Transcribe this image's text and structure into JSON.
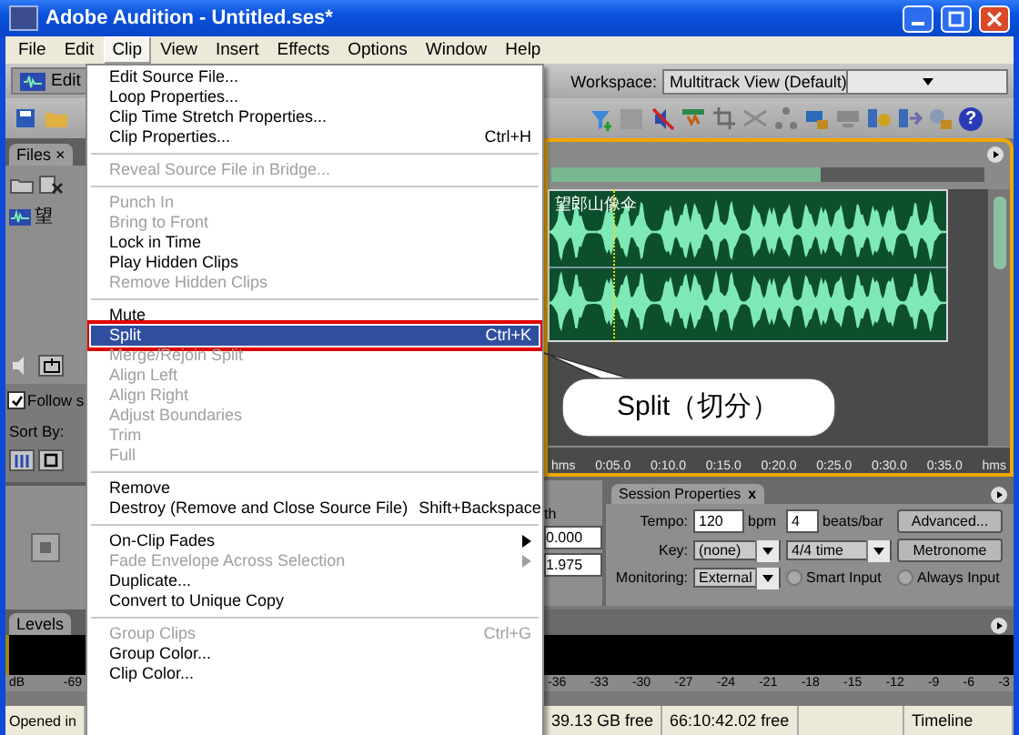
{
  "window": {
    "title": "Adobe Audition - Untitled.ses*"
  },
  "menu_bar": [
    {
      "label": "File",
      "selected": false
    },
    {
      "label": "Edit",
      "selected": false
    },
    {
      "label": "Clip",
      "selected": true
    },
    {
      "label": "View",
      "selected": false
    },
    {
      "label": "Insert",
      "selected": false
    },
    {
      "label": "Effects",
      "selected": false
    },
    {
      "label": "Options",
      "selected": false
    },
    {
      "label": "Window",
      "selected": false
    },
    {
      "label": "Help",
      "selected": false
    }
  ],
  "toolbar": {
    "help_glyph": "?"
  },
  "workspace_bar": {
    "edit_button": "Edit",
    "workspace_label": "Workspace:",
    "workspace_value": "Multitrack View (Default)"
  },
  "clip_menu": {
    "items": [
      {
        "kind": "item",
        "label": "Edit Source File...",
        "disabled": false,
        "selected": false
      },
      {
        "kind": "item",
        "label": "Loop Properties...",
        "disabled": false,
        "selected": false
      },
      {
        "kind": "item",
        "label": "Clip Time Stretch Properties...",
        "disabled": false,
        "selected": false
      },
      {
        "kind": "item",
        "label": "Clip Properties...",
        "shortcut": "Ctrl+H",
        "disabled": false,
        "selected": false
      },
      {
        "kind": "separator"
      },
      {
        "kind": "item",
        "label": "Reveal Source File in Bridge...",
        "disabled": true,
        "selected": false
      },
      {
        "kind": "separator"
      },
      {
        "kind": "item",
        "label": "Punch In",
        "disabled": true,
        "selected": false
      },
      {
        "kind": "item",
        "label": "Bring to Front",
        "disabled": true,
        "selected": false
      },
      {
        "kind": "item",
        "label": "Lock in Time",
        "disabled": false,
        "selected": false
      },
      {
        "kind": "item",
        "label": "Play Hidden Clips",
        "disabled": false,
        "selected": false
      },
      {
        "kind": "item",
        "label": "Remove Hidden Clips",
        "disabled": true,
        "selected": false
      },
      {
        "kind": "separator"
      },
      {
        "kind": "item",
        "label": "Mute",
        "disabled": false,
        "selected": false
      },
      {
        "kind": "item",
        "label": "Split",
        "shortcut": "Ctrl+K",
        "disabled": false,
        "selected": true
      },
      {
        "kind": "item",
        "label": "Merge/Rejoin Split",
        "disabled": true,
        "selected": false
      },
      {
        "kind": "item",
        "label": "Align Left",
        "disabled": true,
        "selected": false
      },
      {
        "kind": "item",
        "label": "Align Right",
        "disabled": true,
        "selected": false
      },
      {
        "kind": "item",
        "label": "Adjust Boundaries",
        "disabled": true,
        "selected": false
      },
      {
        "kind": "item",
        "label": "Trim",
        "disabled": true,
        "selected": false
      },
      {
        "kind": "item",
        "label": "Full",
        "disabled": true,
        "selected": false
      },
      {
        "kind": "separator"
      },
      {
        "kind": "item",
        "label": "Remove",
        "disabled": false,
        "selected": false
      },
      {
        "kind": "item",
        "label": "Destroy (Remove and Close Source File)",
        "shortcut": "Shift+Backspace",
        "disabled": false,
        "selected": false
      },
      {
        "kind": "separator"
      },
      {
        "kind": "submenu",
        "label": "On-Clip Fades",
        "disabled": false,
        "selected": false
      },
      {
        "kind": "submenu",
        "label": "Fade Envelope Across Selection",
        "disabled": true,
        "selected": false
      },
      {
        "kind": "item",
        "label": "Duplicate...",
        "disabled": false,
        "selected": false
      },
      {
        "kind": "item",
        "label": "Convert to Unique Copy",
        "disabled": false,
        "selected": false
      },
      {
        "kind": "separator"
      },
      {
        "kind": "item",
        "label": "Group Clips",
        "shortcut": "Ctrl+G",
        "disabled": true,
        "selected": false
      },
      {
        "kind": "item",
        "label": "Group Color...",
        "disabled": false,
        "selected": false
      },
      {
        "kind": "item",
        "label": "Clip Color...",
        "disabled": false,
        "selected": false
      }
    ]
  },
  "callout": {
    "text": "Split（切分）"
  },
  "files_panel": {
    "tab": "Files",
    "close": "×",
    "file_item": "望",
    "follow_label": "Follow s",
    "follow_checked": true,
    "sort_label": "Sort By:"
  },
  "multitrack": {
    "clip_name": "望郎山像伞",
    "ruler": [
      "hms",
      "0:05.0",
      "0:10.0",
      "0:15.0",
      "0:20.0",
      "0:25.0",
      "0:30.0",
      "0:35.0",
      "hms"
    ]
  },
  "view_panel": {
    "label": "th",
    "values": [
      "0.000",
      "1.975"
    ]
  },
  "session_properties": {
    "tab": "Session Properties",
    "close": "x",
    "tempo_label": "Tempo:",
    "tempo": "120",
    "bpm": "bpm",
    "beats": "4",
    "beats_label": "beats/bar",
    "key_label": "Key:",
    "key": "(none)",
    "time": "4/4 time",
    "monitoring_label": "Monitoring:",
    "monitoring": "External",
    "advanced": "Advanced...",
    "metronome": "Metronome",
    "smart_input": {
      "label": "Smart Input",
      "selected": false
    },
    "always_input": {
      "label": "Always Input",
      "selected": false
    }
  },
  "levels": {
    "tab": "Levels",
    "left_scale": [
      "dB",
      "-69"
    ],
    "right_scale": [
      "-36",
      "-33",
      "-30",
      "-27",
      "-24",
      "-21",
      "-18",
      "-15",
      "-12",
      "-9",
      "-6",
      "-3"
    ]
  },
  "status_bar": {
    "left": "Opened in",
    "cells": [
      "39.13 GB free",
      "66:10:42.02 free"
    ],
    "last": "Timeline"
  }
}
